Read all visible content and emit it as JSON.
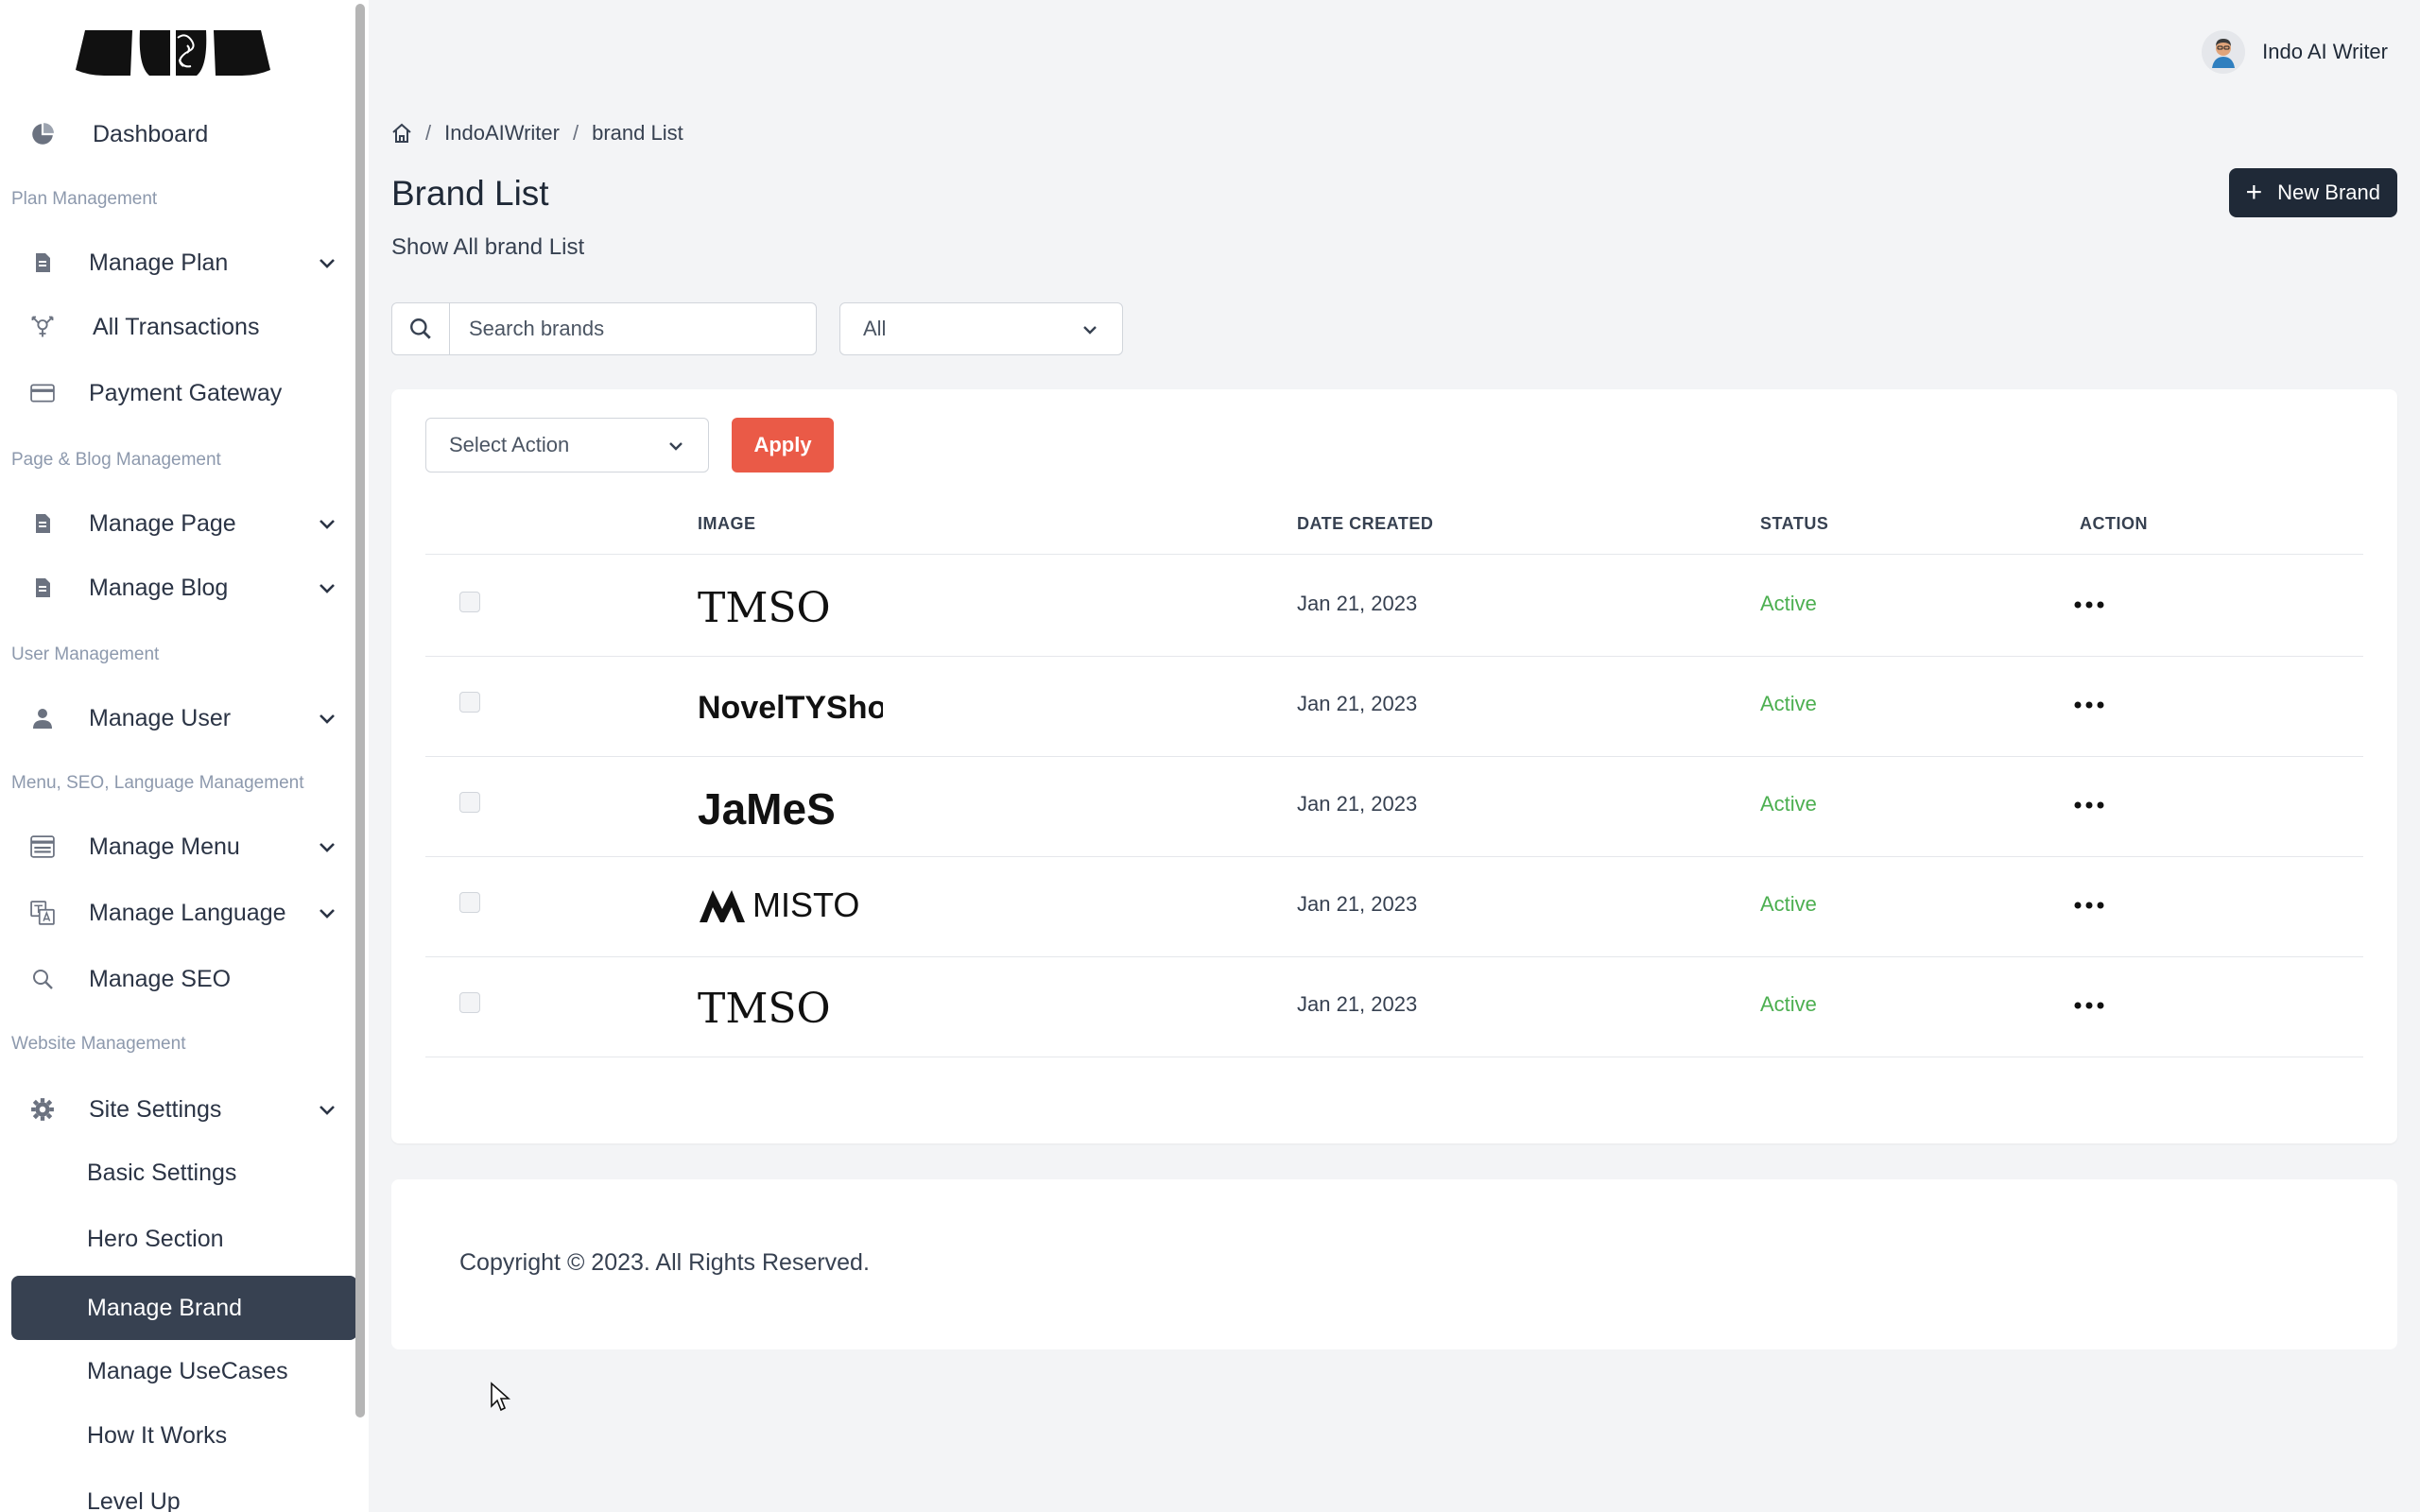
{
  "header": {
    "user_name": "Indo AI Writer"
  },
  "sidebar": {
    "dashboard": "Dashboard",
    "sections": {
      "plan": "Plan Management",
      "page_blog": "Page & Blog Management",
      "user": "User Management",
      "menu_seo": "Menu, SEO, Language Management",
      "website": "Website Management"
    },
    "items": {
      "manage_plan": "Manage Plan",
      "all_transactions": "All Transactions",
      "payment_gateway": "Payment Gateway",
      "manage_page": "Manage Page",
      "manage_blog": "Manage Blog",
      "manage_user": "Manage User",
      "manage_menu": "Manage Menu",
      "manage_language": "Manage Language",
      "manage_seo": "Manage SEO",
      "site_settings": "Site Settings"
    },
    "sub_items": {
      "basic_settings": "Basic Settings",
      "hero_section": "Hero Section",
      "manage_brand": "Manage Brand",
      "manage_usecases": "Manage UseCases",
      "how_it_works": "How It Works",
      "level_up": "Level Up"
    }
  },
  "breadcrumb": {
    "home_sep": "/",
    "level1": "IndoAIWriter",
    "level2": "brand List"
  },
  "page": {
    "title": "Brand List",
    "subtitle": "Show All brand List",
    "new_button": "New Brand"
  },
  "filters": {
    "search_placeholder": "Search brands",
    "status_value": "All"
  },
  "bulk": {
    "action_placeholder": "Select Action",
    "apply_label": "Apply"
  },
  "table": {
    "headers": {
      "image": "IMAGE",
      "date": "DATE CREATED",
      "status": "STATUS",
      "action": "ACTION"
    },
    "rows": [
      {
        "logo": "TMSO",
        "date": "Jan 21, 2023",
        "status": "Active"
      },
      {
        "logo": "NovelTYShop",
        "date": "Jan 21, 2023",
        "status": "Active"
      },
      {
        "logo": "JaMeS",
        "date": "Jan 21, 2023",
        "status": "Active"
      },
      {
        "logo": "MISTO",
        "date": "Jan 21, 2023",
        "status": "Active"
      },
      {
        "logo": "TMSO",
        "date": "Jan 21, 2023",
        "status": "Active"
      }
    ]
  },
  "footer": {
    "copyright": "Copyright © 2023. All Rights Reserved."
  },
  "colors": {
    "accent": "#ea5a47",
    "dark": "#1f2937",
    "active_status": "#4caf50",
    "active_nav": "#374151"
  }
}
